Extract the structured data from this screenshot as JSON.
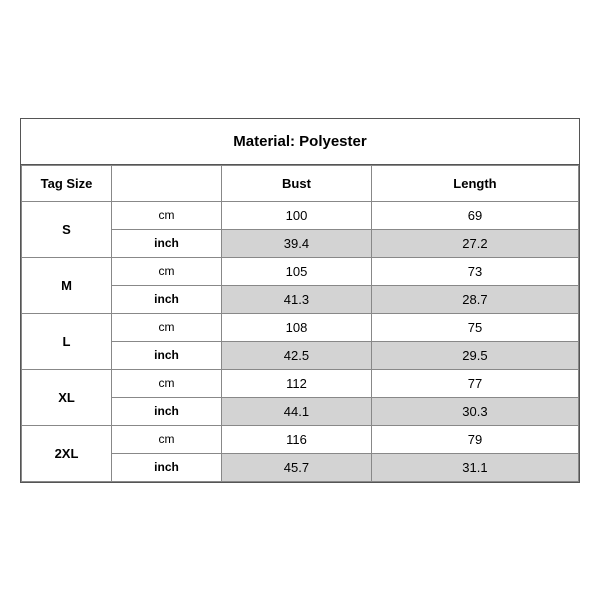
{
  "title": "Material: Polyester",
  "headers": {
    "tag_size": "Tag Size",
    "bust": "Bust",
    "length": "Length"
  },
  "sizes": [
    {
      "label": "S",
      "cm": {
        "bust": "100",
        "length": "69"
      },
      "inch": {
        "bust": "39.4",
        "length": "27.2"
      }
    },
    {
      "label": "M",
      "cm": {
        "bust": "105",
        "length": "73"
      },
      "inch": {
        "bust": "41.3",
        "length": "28.7"
      }
    },
    {
      "label": "L",
      "cm": {
        "bust": "108",
        "length": "75"
      },
      "inch": {
        "bust": "42.5",
        "length": "29.5"
      }
    },
    {
      "label": "XL",
      "cm": {
        "bust": "112",
        "length": "77"
      },
      "inch": {
        "bust": "44.1",
        "length": "30.3"
      }
    },
    {
      "label": "2XL",
      "cm": {
        "bust": "116",
        "length": "79"
      },
      "inch": {
        "bust": "45.7",
        "length": "31.1"
      }
    }
  ],
  "units": {
    "cm": "cm",
    "inch": "inch"
  }
}
